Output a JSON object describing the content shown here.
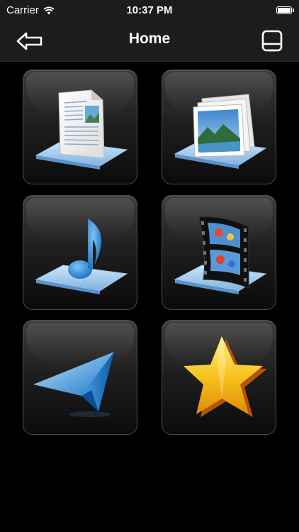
{
  "status_bar": {
    "carrier": "Carrier",
    "time": "10:37 PM",
    "battery_level": 1.0
  },
  "nav": {
    "title": "Home"
  },
  "tiles": [
    {
      "id": "documents",
      "icon": "document-icon"
    },
    {
      "id": "photos",
      "icon": "photos-icon"
    },
    {
      "id": "music",
      "icon": "music-note-icon"
    },
    {
      "id": "videos",
      "icon": "film-strip-icon"
    },
    {
      "id": "send",
      "icon": "paper-plane-icon"
    },
    {
      "id": "favorites",
      "icon": "star-icon"
    }
  ],
  "colors": {
    "background": "#000000",
    "bar": "#1c1c1c",
    "tile_top": "#3c3c3c",
    "tile_bottom": "#0b0b0b",
    "accent_blue": "#3a8fd6",
    "star_yellow": "#f7c51e"
  }
}
